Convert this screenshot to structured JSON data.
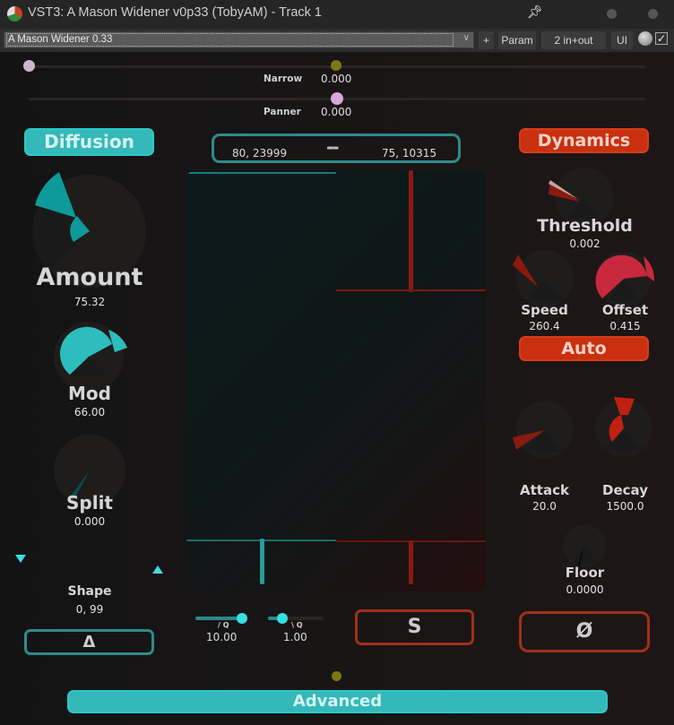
{
  "window": {
    "title": "VST3: A Mason Widener v0p33 (TobyAM) - Track 1",
    "pin_icon": "pin-icon"
  },
  "toolbar": {
    "preset_name": "A Mason Widener 0.33",
    "add_label": "+",
    "param_label": "Param",
    "io_label": "2 in+out",
    "ui_label": "UI",
    "bypass_checked": true
  },
  "top_sliders": {
    "narrow": {
      "label": "Narrow",
      "value": "0.000",
      "position": 0.5
    },
    "panner": {
      "label": "Panner",
      "value": "0.000",
      "position": 0.5
    },
    "left_thumb_position": 0.0
  },
  "diffusion": {
    "header": "Diffusion",
    "amount": {
      "label": "Amount",
      "value": "75.32",
      "fill": 0.75
    },
    "mod": {
      "label": "Mod",
      "value": "66.00",
      "fill": 0.66
    },
    "split": {
      "label": "Split",
      "value": "0.000",
      "fill": 0.0
    },
    "shape": {
      "label": "Shape",
      "value": "0, 99"
    },
    "delta_button": "Δ"
  },
  "center": {
    "readout_left": "80, 23999",
    "readout_mid": "--",
    "readout_right": "75, 10315",
    "q_up": {
      "label": "/ Q",
      "value": "10.00",
      "position": 1.0
    },
    "q_down": {
      "label": "\\ Q",
      "value": "1.00",
      "position": 0.25
    },
    "s_button": "S"
  },
  "dynamics": {
    "header": "Dynamics",
    "threshold": {
      "label": "Threshold",
      "value": "0.002"
    },
    "speed": {
      "label": "Speed",
      "value": "260.4"
    },
    "offset": {
      "label": "Offset",
      "value": "0.415"
    },
    "auto_button": "Auto",
    "attack": {
      "label": "Attack",
      "value": "20.0"
    },
    "decay": {
      "label": "Decay",
      "value": "1500.0"
    },
    "floor": {
      "label": "Floor",
      "value": "0.0000"
    },
    "phase_button": "Ø"
  },
  "advanced_button": "Advanced",
  "colors": {
    "teal": "#35b8b8",
    "red": "#c9300f",
    "narrow_thumb": "#7a7a10",
    "panner_thumb": "#d9a6d9"
  }
}
